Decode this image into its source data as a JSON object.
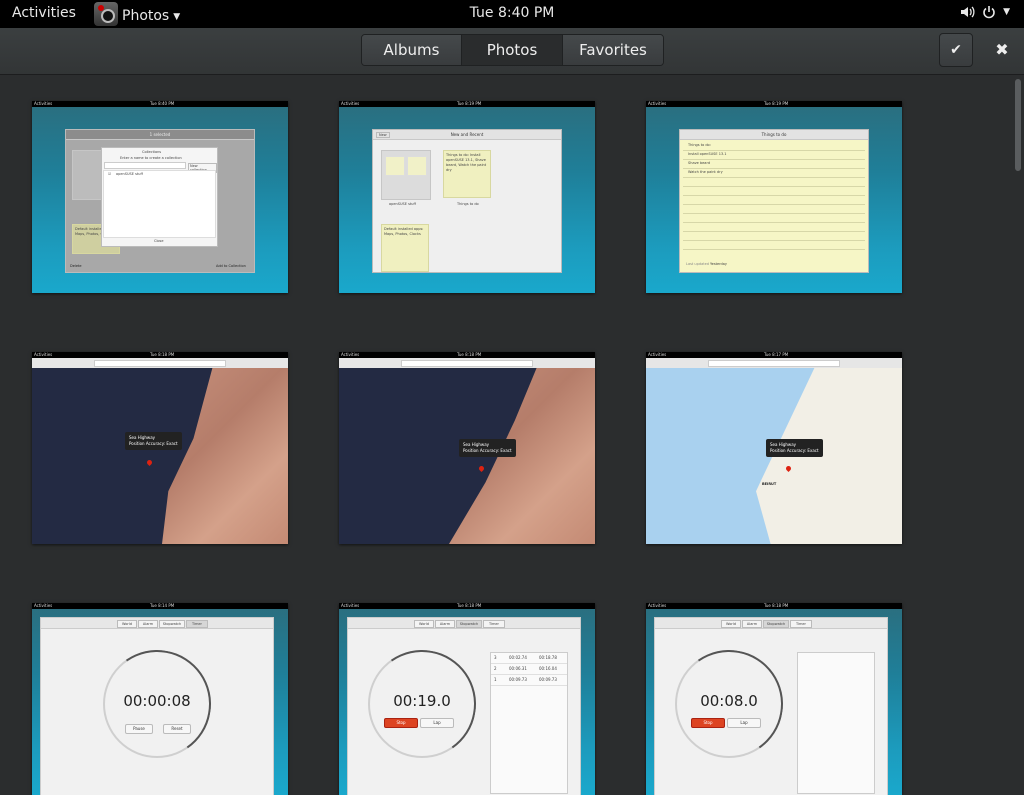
{
  "topbar": {
    "activities": "Activities",
    "app_name": "Photos",
    "clock": "Tue  8:40 PM"
  },
  "header": {
    "tabs": [
      "Albums",
      "Photos",
      "Favorites"
    ],
    "active_tab": "Photos",
    "select_icon": "checkmark-icon",
    "close_icon": "close-icon"
  },
  "thumbs": {
    "t1": {
      "time": "Tue  8:40 PM",
      "title": "1 selected",
      "dialog_title": "Collections",
      "prompt": "Enter a name to create a collection",
      "new_btn": "New collection",
      "item": "openSUSE stuff",
      "close": "Close",
      "delete": "Delete",
      "add": "Add to Collection",
      "note": "Default installed apps: Maps, Photos, Clocks"
    },
    "t2": {
      "time": "Tue  8:19 PM",
      "title": "New and Recent",
      "new": "New",
      "folder_label": "openSUSE stuff",
      "note_label": "Things to do",
      "note": "Things to do: Install openSUSE 13.1, Shave beard, Watch the paint dry",
      "note2": "Default installed apps: Maps, Photos, Clocks"
    },
    "t3": {
      "time": "Tue  8:19 PM",
      "title": "Things to do",
      "lines": [
        "Things to do:",
        "Install openSUSE 13.1",
        "Shave beard",
        "Watch the paint dry"
      ],
      "footer1": "Last updated",
      "footer2": "Yesterday"
    },
    "t4": {
      "time": "Tue  8:18 PM",
      "popup1": "Sea Highway",
      "popup2": "Position Accuracy: Exact"
    },
    "t5": {
      "time": "Tue  8:18 PM",
      "popup1": "Sea Highway",
      "popup2": "Position Accuracy: Exact"
    },
    "t6": {
      "time": "Tue  8:17 PM",
      "popup1": "Sea Highway",
      "popup2": "Position Accuracy: Exact",
      "city": "BEIRUT"
    },
    "t7": {
      "time": "Tue  8:14 PM",
      "tabs": [
        "World",
        "Alarm",
        "Stopwatch",
        "Timer"
      ],
      "display": "00:00:08",
      "btn1": "Pause",
      "btn2": "Reset"
    },
    "t8": {
      "time": "Tue  8:18 PM",
      "tabs": [
        "World",
        "Alarm",
        "Stopwatch",
        "Timer"
      ],
      "display": "00:19.0",
      "btn1": "Stop",
      "btn2": "Lap",
      "laps": [
        [
          "3",
          "00:02.74",
          "00:18.78"
        ],
        [
          "2",
          "00:06.31",
          "00:16.04"
        ],
        [
          "1",
          "00:09.73",
          "00:09.73"
        ]
      ]
    },
    "t9": {
      "time": "Tue  8:18 PM",
      "tabs": [
        "World",
        "Alarm",
        "Stopwatch",
        "Timer"
      ],
      "display": "00:08.0",
      "btn1": "Stop",
      "btn2": "Lap"
    }
  }
}
